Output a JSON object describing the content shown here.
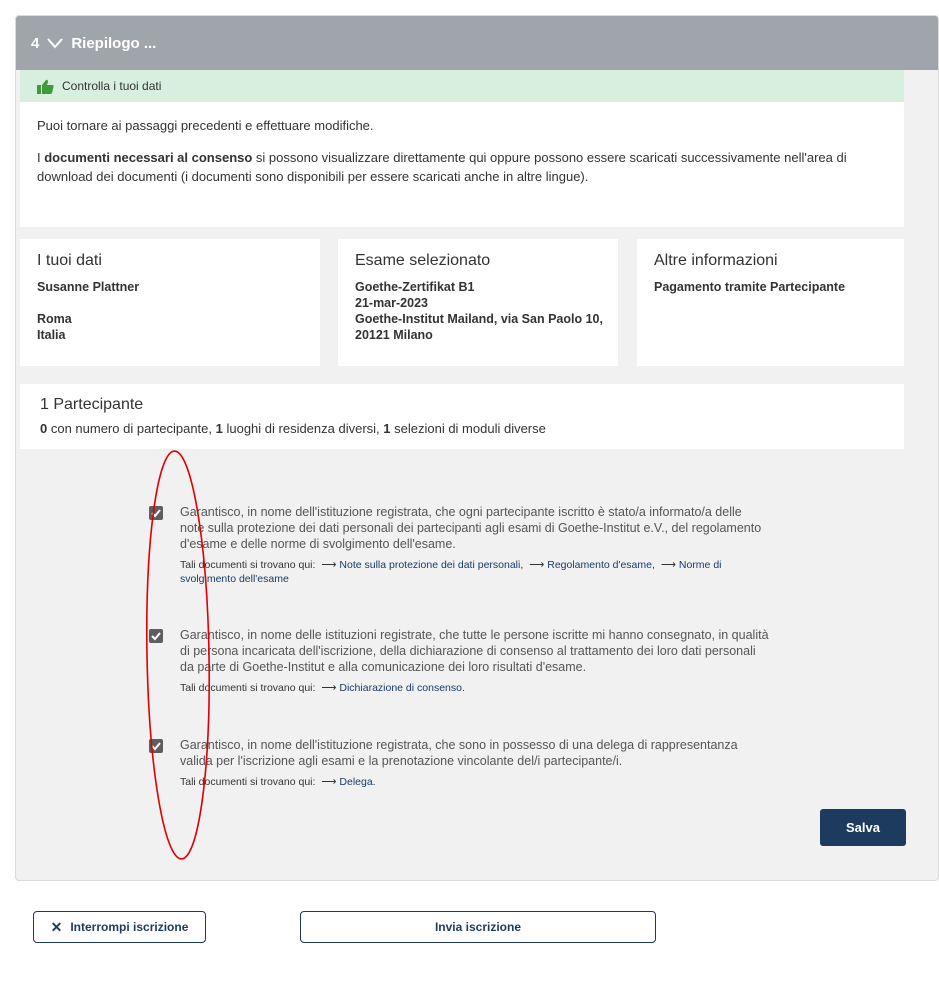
{
  "section": {
    "step": "4",
    "title": "Riepilogo ..."
  },
  "notice": {
    "title": "Controlla i tuoi dati",
    "para1": "Puoi tornare ai passaggi precedenti e effettuare modifiche.",
    "para2_pre": "I ",
    "para2_bold": "documenti necessari al consenso",
    "para2_post": " si possono visualizzare direttamente qui oppure possono essere scaricati successivamente nell'area di download dei documenti (i documenti sono disponibili per essere scaricati anche in altre lingue)."
  },
  "cards": {
    "personal": {
      "heading": "I tuoi dati",
      "name": "Susanne Plattner",
      "city": "Roma",
      "country": "Italia"
    },
    "exam": {
      "heading": "Esame selezionato",
      "exam_name": "Goethe-Zertifikat B1",
      "date": "21-mar-2023",
      "location": "Goethe-Institut Mailand, via San Paolo 10, 20121 Milano"
    },
    "other": {
      "heading": "Altre informazioni",
      "payment": "Pagamento tramite Partecipante"
    }
  },
  "participants": {
    "heading": "1 Partecipante",
    "count_with_number": "0",
    "text_with_number": " con numero di partecipante, ",
    "count_residences": "1",
    "text_residences": " luoghi di residenza diversi, ",
    "count_modules": "1",
    "text_modules": " selezioni di moduli diverse"
  },
  "consents": [
    {
      "checked": true,
      "text": "Garantisco, in nome dell'istituzione registrata, che ogni partecipante iscritto è stato/a informato/a delle note sulla protezione dei dati personali dei partecipanti agli esami di Goethe-Institut e.V., del regolamento d'esame e delle norme di svolgimento dell'esame.",
      "docs_prefix": "Tali documenti si trovano qui:",
      "links": [
        "Note sulla protezione dei dati personali",
        "Regolamento d'esame",
        "Norme di svolgimento dell'esame"
      ]
    },
    {
      "checked": true,
      "text": "Garantisco, in nome delle istituzioni registrate, che tutte le persone iscritte mi hanno consegnato, in qualità di persona incaricata dell'iscrizione, della dichiarazione di consenso al trattamento dei loro dati personali da parte di Goethe-Institut e alla comunicazione dei loro risultati d'esame.",
      "docs_prefix": "Tali documenti si trovano qui:",
      "links": [
        "Dichiarazione di consenso"
      ]
    },
    {
      "checked": true,
      "text": "Garantisco, in nome dell'istituzione registrata, che sono in possesso di una delega di rappresentanza valida per l'iscrizione agli esami e la prenotazione vincolante del/i partecipante/i.",
      "docs_prefix": "Tali documenti si trovano qui:",
      "links": [
        "Delega"
      ]
    }
  ],
  "buttons": {
    "save": "Salva",
    "cancel": "Interrompi iscrizione",
    "submit": "Invia iscrizione"
  },
  "colors": {
    "header_bg": "#a0a5ab",
    "notice_bg": "#d8eedf",
    "thumb_green": "#3f9a3a",
    "primary": "#1d3a5f",
    "annotation_red": "#e00000"
  },
  "icons": {
    "chevron": "chevron-down-icon",
    "thumb": "thumbs-up-icon",
    "check": "checkbox-checked-icon",
    "arrow": "arrow-right-icon",
    "close": "close-icon"
  }
}
